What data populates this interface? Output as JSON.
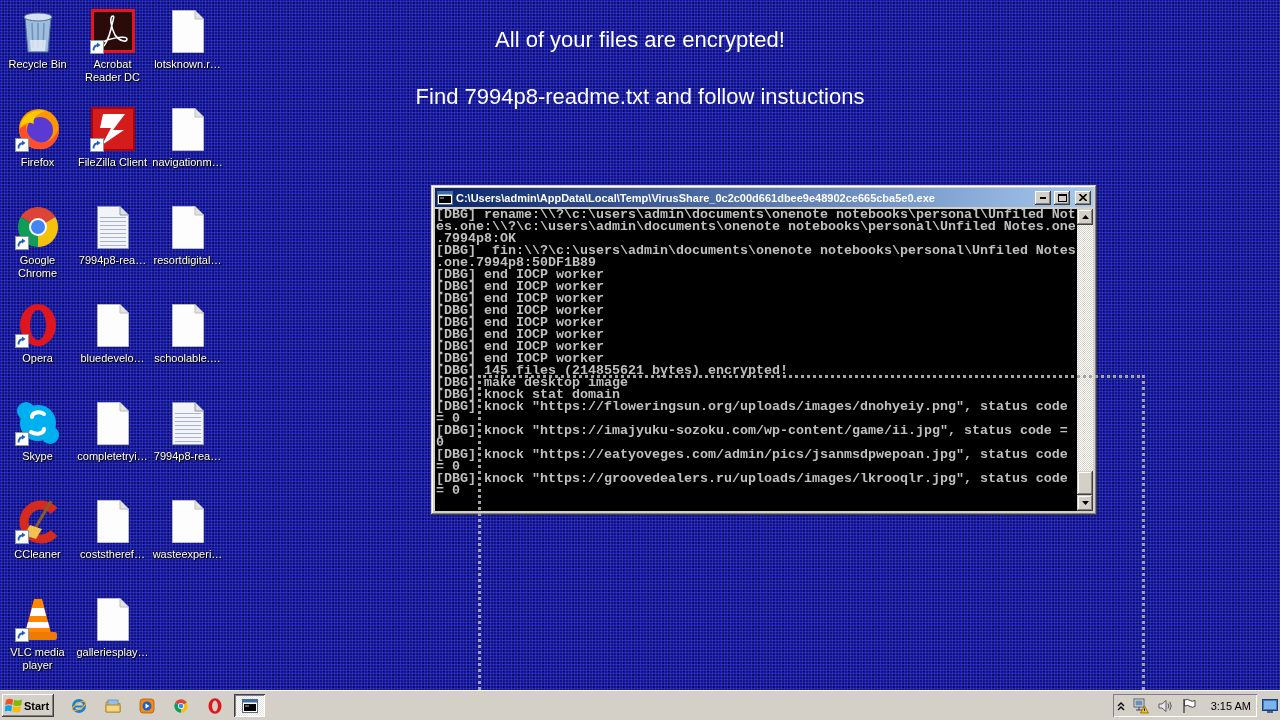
{
  "wallpaper": {
    "lines": [
      "All of your files are encrypted!",
      "Find 7994p8-readme.txt and follow instuctions"
    ]
  },
  "desktop_icons": [
    {
      "label": "Recycle Bin",
      "kind": "system",
      "selected": false
    },
    {
      "label": "Firefox",
      "kind": "shortcut",
      "selected": false
    },
    {
      "label": "Google Chrome",
      "kind": "shortcut",
      "selected": false
    },
    {
      "label": "Opera",
      "kind": "shortcut",
      "selected": false
    },
    {
      "label": "Skype",
      "kind": "shortcut",
      "selected": false
    },
    {
      "label": "CCleaner",
      "kind": "shortcut",
      "selected": false
    },
    {
      "label": "VLC media player",
      "kind": "shortcut",
      "selected": false
    },
    {
      "label": "Acrobat Reader DC",
      "kind": "shortcut",
      "selected": false
    },
    {
      "label": "FileZilla Client",
      "kind": "shortcut",
      "selected": false
    },
    {
      "label": "7994p8-rea…",
      "kind": "text-file",
      "selected": false
    },
    {
      "label": "bluedevelo…",
      "kind": "file",
      "selected": false
    },
    {
      "label": "completetryi…",
      "kind": "file",
      "selected": false
    },
    {
      "label": "coststheref…",
      "kind": "file",
      "selected": false
    },
    {
      "label": "galleriesplay…",
      "kind": "file",
      "selected": false
    },
    {
      "label": "lotsknown.r…",
      "kind": "file",
      "selected": false
    },
    {
      "label": "navigationm…",
      "kind": "file",
      "selected": false
    },
    {
      "label": "resortdigital…",
      "kind": "file",
      "selected": false
    },
    {
      "label": "schoolable.…",
      "kind": "file",
      "selected": false
    },
    {
      "label": "7994p8-rea…",
      "kind": "text-file",
      "selected": false
    },
    {
      "label": "wasteexperi…",
      "kind": "file",
      "selected": false
    }
  ],
  "console_window": {
    "title": "C:\\Users\\admin\\AppData\\Local\\Temp\\VirusShare_0c2c00d661dbee9e48902ce665cba5e0.exe",
    "lines": [
      {
        "tag": "[DBG]",
        "text": "rename:\\\\?\\c:\\users\\admin\\documents\\onenote notebooks\\personal\\Unfiled Not"
      },
      {
        "text": "es.one:\\\\?\\c:\\users\\admin\\documents\\onenote notebooks\\personal\\Unfiled Notes.one"
      },
      {
        "text": ".7994p8:OK"
      },
      {
        "tag": "[DBG]",
        "text": " fin:\\\\?\\c:\\users\\admin\\documents\\onenote notebooks\\personal\\Unfiled Notes"
      },
      {
        "text": ".one.7994p8:50DF1B89"
      },
      {
        "tag": "[DBG]",
        "text": "end IOCP worker"
      },
      {
        "tag": "[DBG]",
        "text": "end IOCP worker"
      },
      {
        "tag": "[DBG]",
        "text": "end IOCP worker"
      },
      {
        "tag": "[DBG]",
        "text": "end IOCP worker"
      },
      {
        "tag": "[DBG]",
        "text": "end IOCP worker"
      },
      {
        "tag": "[DBG]",
        "text": "end IOCP worker"
      },
      {
        "tag": "[DBG]",
        "text": "end IOCP worker"
      },
      {
        "tag": "[DBG]",
        "text": "end IOCP worker"
      },
      {
        "tag": "[DBG]",
        "text": "145 files (214855621 bytes) encrypted!"
      },
      {
        "tag": "[DBG]",
        "text": "make desktop image"
      },
      {
        "tag": "[DBG]",
        "text": "knock stat domain"
      },
      {
        "tag": "[DBG]",
        "text": "knock \"https://floweringsun.org/uploads/images/dnohyeiy.png\", status code"
      },
      {
        "text": "= 0"
      },
      {
        "tag": "[DBG]",
        "text": "knock \"https://imajyuku-sozoku.com/wp-content/game/ii.jpg\", status code ="
      },
      {
        "text": "0"
      },
      {
        "tag": "[DBG]",
        "text": "knock \"https://eatyoveges.com/admin/pics/jsanmsdpwepoan.jpg\", status code"
      },
      {
        "text": "= 0"
      },
      {
        "tag": "[DBG]",
        "text": "knock \"https://groovedealers.ru/uploads/images/lkrooqlr.jpg\", status code"
      },
      {
        "text": "= 0"
      }
    ]
  },
  "taskbar": {
    "start_label": "Start",
    "tasks": [
      {
        "selected": true
      }
    ],
    "clock": "3:15 AM"
  }
}
